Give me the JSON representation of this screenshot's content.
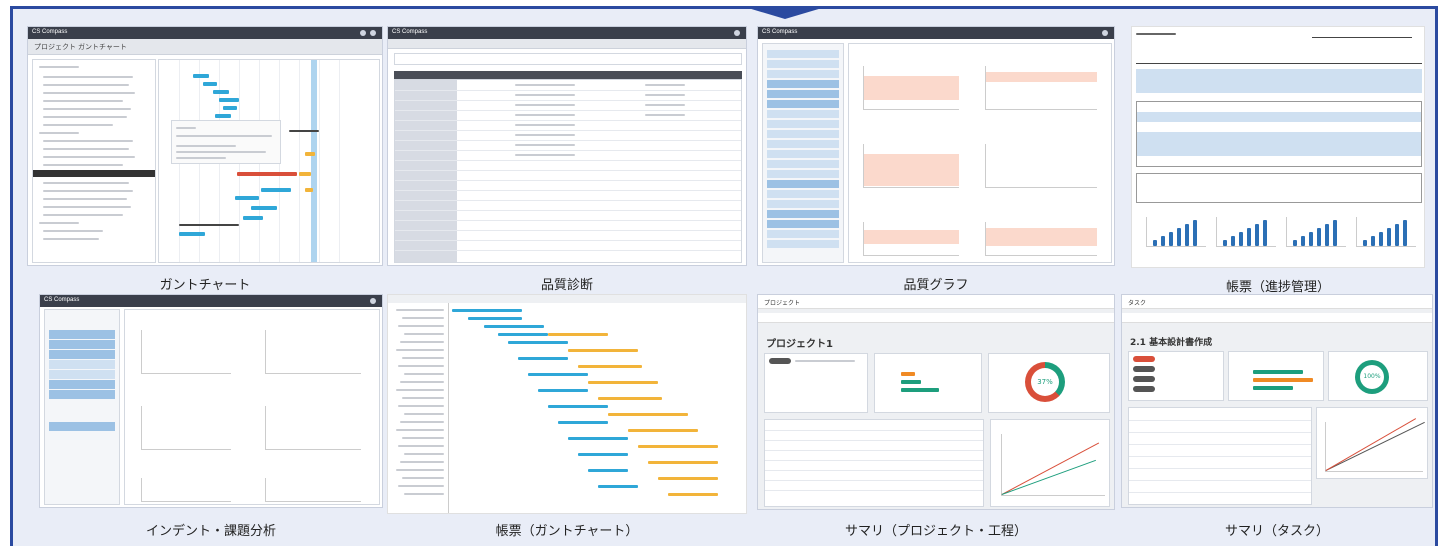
{
  "colors": {
    "frame": "#2b4aa0",
    "background": "#e9edf7",
    "accent_blue": "#2fa7d8",
    "accent_orange": "#f2b43a",
    "accent_teal": "#1d9e7d",
    "accent_red": "#d94f3a"
  },
  "tiles": [
    {
      "caption": "ガントチャート",
      "header_title": "プロジェクト ガントチャート",
      "brand": "CS Compass"
    },
    {
      "caption": "品質診断",
      "brand": "CS Compass"
    },
    {
      "caption": "品質グラフ",
      "brand": "CS Compass"
    },
    {
      "caption": "帳票（進捗管理）"
    },
    {
      "caption": "インデント・課題分析",
      "brand": "CS Compass"
    },
    {
      "caption": "帳票（ガントチャート）"
    },
    {
      "caption": "サマリ（プロジェクト・工程）",
      "header_title": "プロジェクト",
      "project_name": "プロジェクト1",
      "progress_percent": 37,
      "progress_label": "37%"
    },
    {
      "caption": "サマリ（タスク）",
      "header_title": "タスク",
      "task_title": "2.1 基本設計書作成",
      "progress_percent": 100,
      "progress_label": "100%"
    }
  ]
}
